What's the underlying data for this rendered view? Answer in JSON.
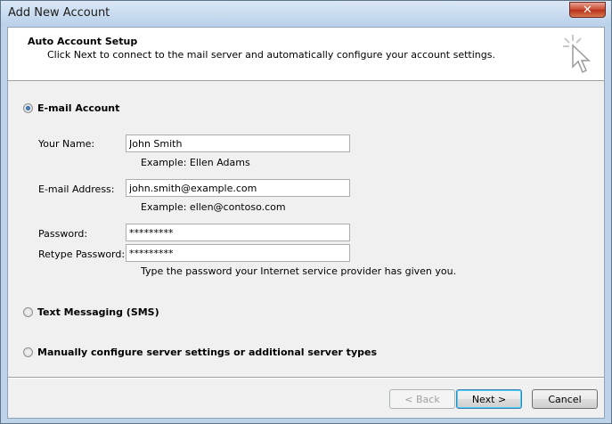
{
  "window": {
    "title": "Add New Account",
    "close_glyph": "✕"
  },
  "header": {
    "title": "Auto Account Setup",
    "subtitle": "Click Next to connect to the mail server and automatically configure your account settings."
  },
  "options": {
    "email": {
      "label": "E-mail Account",
      "selected": true
    },
    "sms": {
      "label": "Text Messaging (SMS)",
      "selected": false
    },
    "manual": {
      "label": "Manually configure server settings or additional server types",
      "selected": false
    }
  },
  "form": {
    "name_label": "Your Name:",
    "name_value": "John Smith",
    "name_example": "Example: Ellen Adams",
    "email_label": "E-mail Address:",
    "email_value": "john.smith@example.com",
    "email_example": "Example: ellen@contoso.com",
    "password_label": "Password:",
    "password_value": "*********",
    "retype_label": "Retype Password:",
    "retype_value": "*********",
    "password_hint": "Type the password your Internet service provider has given you."
  },
  "buttons": {
    "back": "< Back",
    "next": "Next >",
    "cancel": "Cancel"
  }
}
